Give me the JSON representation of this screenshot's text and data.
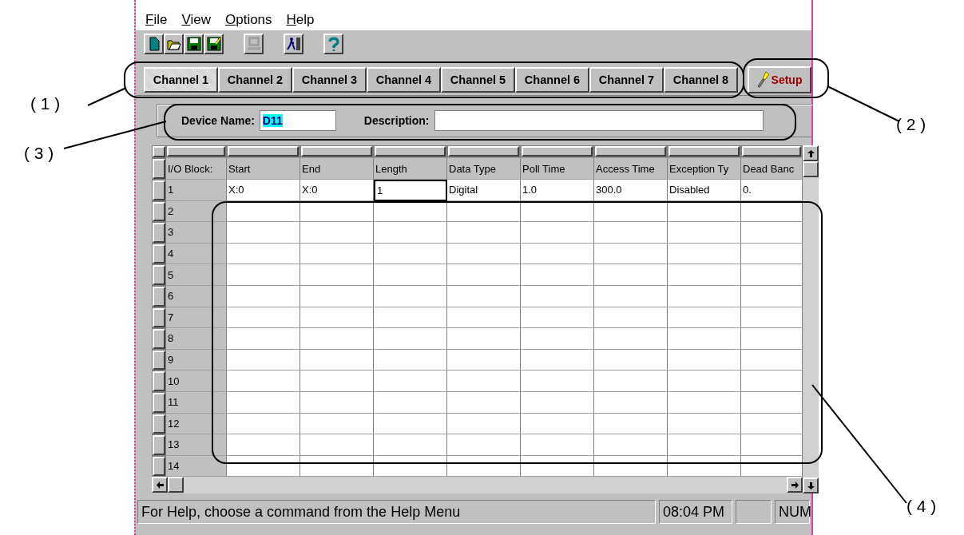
{
  "menu": [
    {
      "label": "File"
    },
    {
      "label": "View"
    },
    {
      "label": "Options"
    },
    {
      "label": "Help"
    }
  ],
  "toolbar": [
    [
      {
        "kind": "new",
        "disabled": false
      },
      {
        "kind": "open",
        "disabled": false
      },
      {
        "kind": "save",
        "disabled": false
      },
      {
        "kind": "save-as",
        "disabled": false
      }
    ],
    [
      {
        "kind": "computer",
        "disabled": true
      }
    ],
    [
      {
        "kind": "exit",
        "disabled": false
      }
    ],
    [
      {
        "kind": "help",
        "disabled": false
      }
    ]
  ],
  "tabs": [
    {
      "label": "Channel 1",
      "selected": true
    },
    {
      "label": "Channel 2",
      "selected": false
    },
    {
      "label": "Channel 3",
      "selected": false
    },
    {
      "label": "Channel 4",
      "selected": false
    },
    {
      "label": "Channel 5",
      "selected": false
    },
    {
      "label": "Channel 6",
      "selected": false
    },
    {
      "label": "Channel 7",
      "selected": false
    },
    {
      "label": "Channel 8",
      "selected": false
    }
  ],
  "setup_button": {
    "label": "Setup"
  },
  "device": {
    "name_label": "Device Name:",
    "name_value": "D11",
    "name_selected": true,
    "description_label": "Description:"
  },
  "grid": {
    "corner": "I/O Block:",
    "columns": [
      "Start",
      "End",
      "Length",
      "Data Type",
      "Poll Time",
      "Access Time",
      "Exception Ty",
      "Dead Banc"
    ],
    "rows": [
      {
        "label": "1",
        "cells": [
          {
            "text": "X:0",
            "selected": false
          },
          {
            "text": "X:0",
            "selected": false
          },
          {
            "text": "1",
            "selected": true
          },
          {
            "text": "Digital",
            "selected": false
          },
          {
            "text": "1.0",
            "selected": false
          },
          {
            "text": "300.0",
            "selected": false
          },
          {
            "text": "Disabled",
            "selected": false
          },
          {
            "text": "0.",
            "selected": false
          }
        ]
      },
      {
        "label": "2"
      },
      {
        "label": "3"
      },
      {
        "label": "4"
      },
      {
        "label": "5"
      },
      {
        "label": "6"
      },
      {
        "label": "7"
      },
      {
        "label": "8"
      },
      {
        "label": "9"
      },
      {
        "label": "10"
      },
      {
        "label": "11"
      },
      {
        "label": "12"
      },
      {
        "label": "13"
      },
      {
        "label": "14"
      }
    ]
  },
  "status_bar": {
    "message": "For Help, choose a command from the Help Menu",
    "time": "08:04 PM",
    "indicator": "NUM"
  },
  "callouts": [
    {
      "label": "( 1 )"
    },
    {
      "label": "( 2 )"
    },
    {
      "label": "( 3 )"
    },
    {
      "label": "( 4 )"
    }
  ]
}
